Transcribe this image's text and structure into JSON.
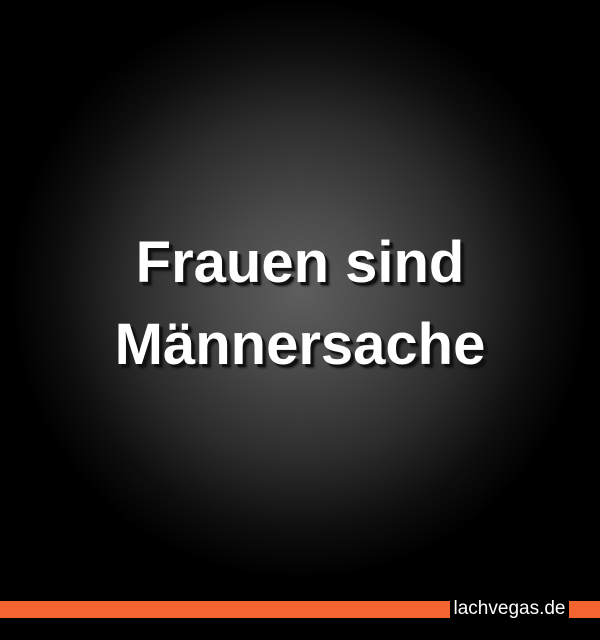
{
  "headline": {
    "line1": "Frauen sind",
    "line2": "Männersache"
  },
  "footer": {
    "brand": "lachvegas.de",
    "accent_color": "#f26430"
  },
  "colors": {
    "background": "#000000",
    "text": "#ffffff"
  }
}
